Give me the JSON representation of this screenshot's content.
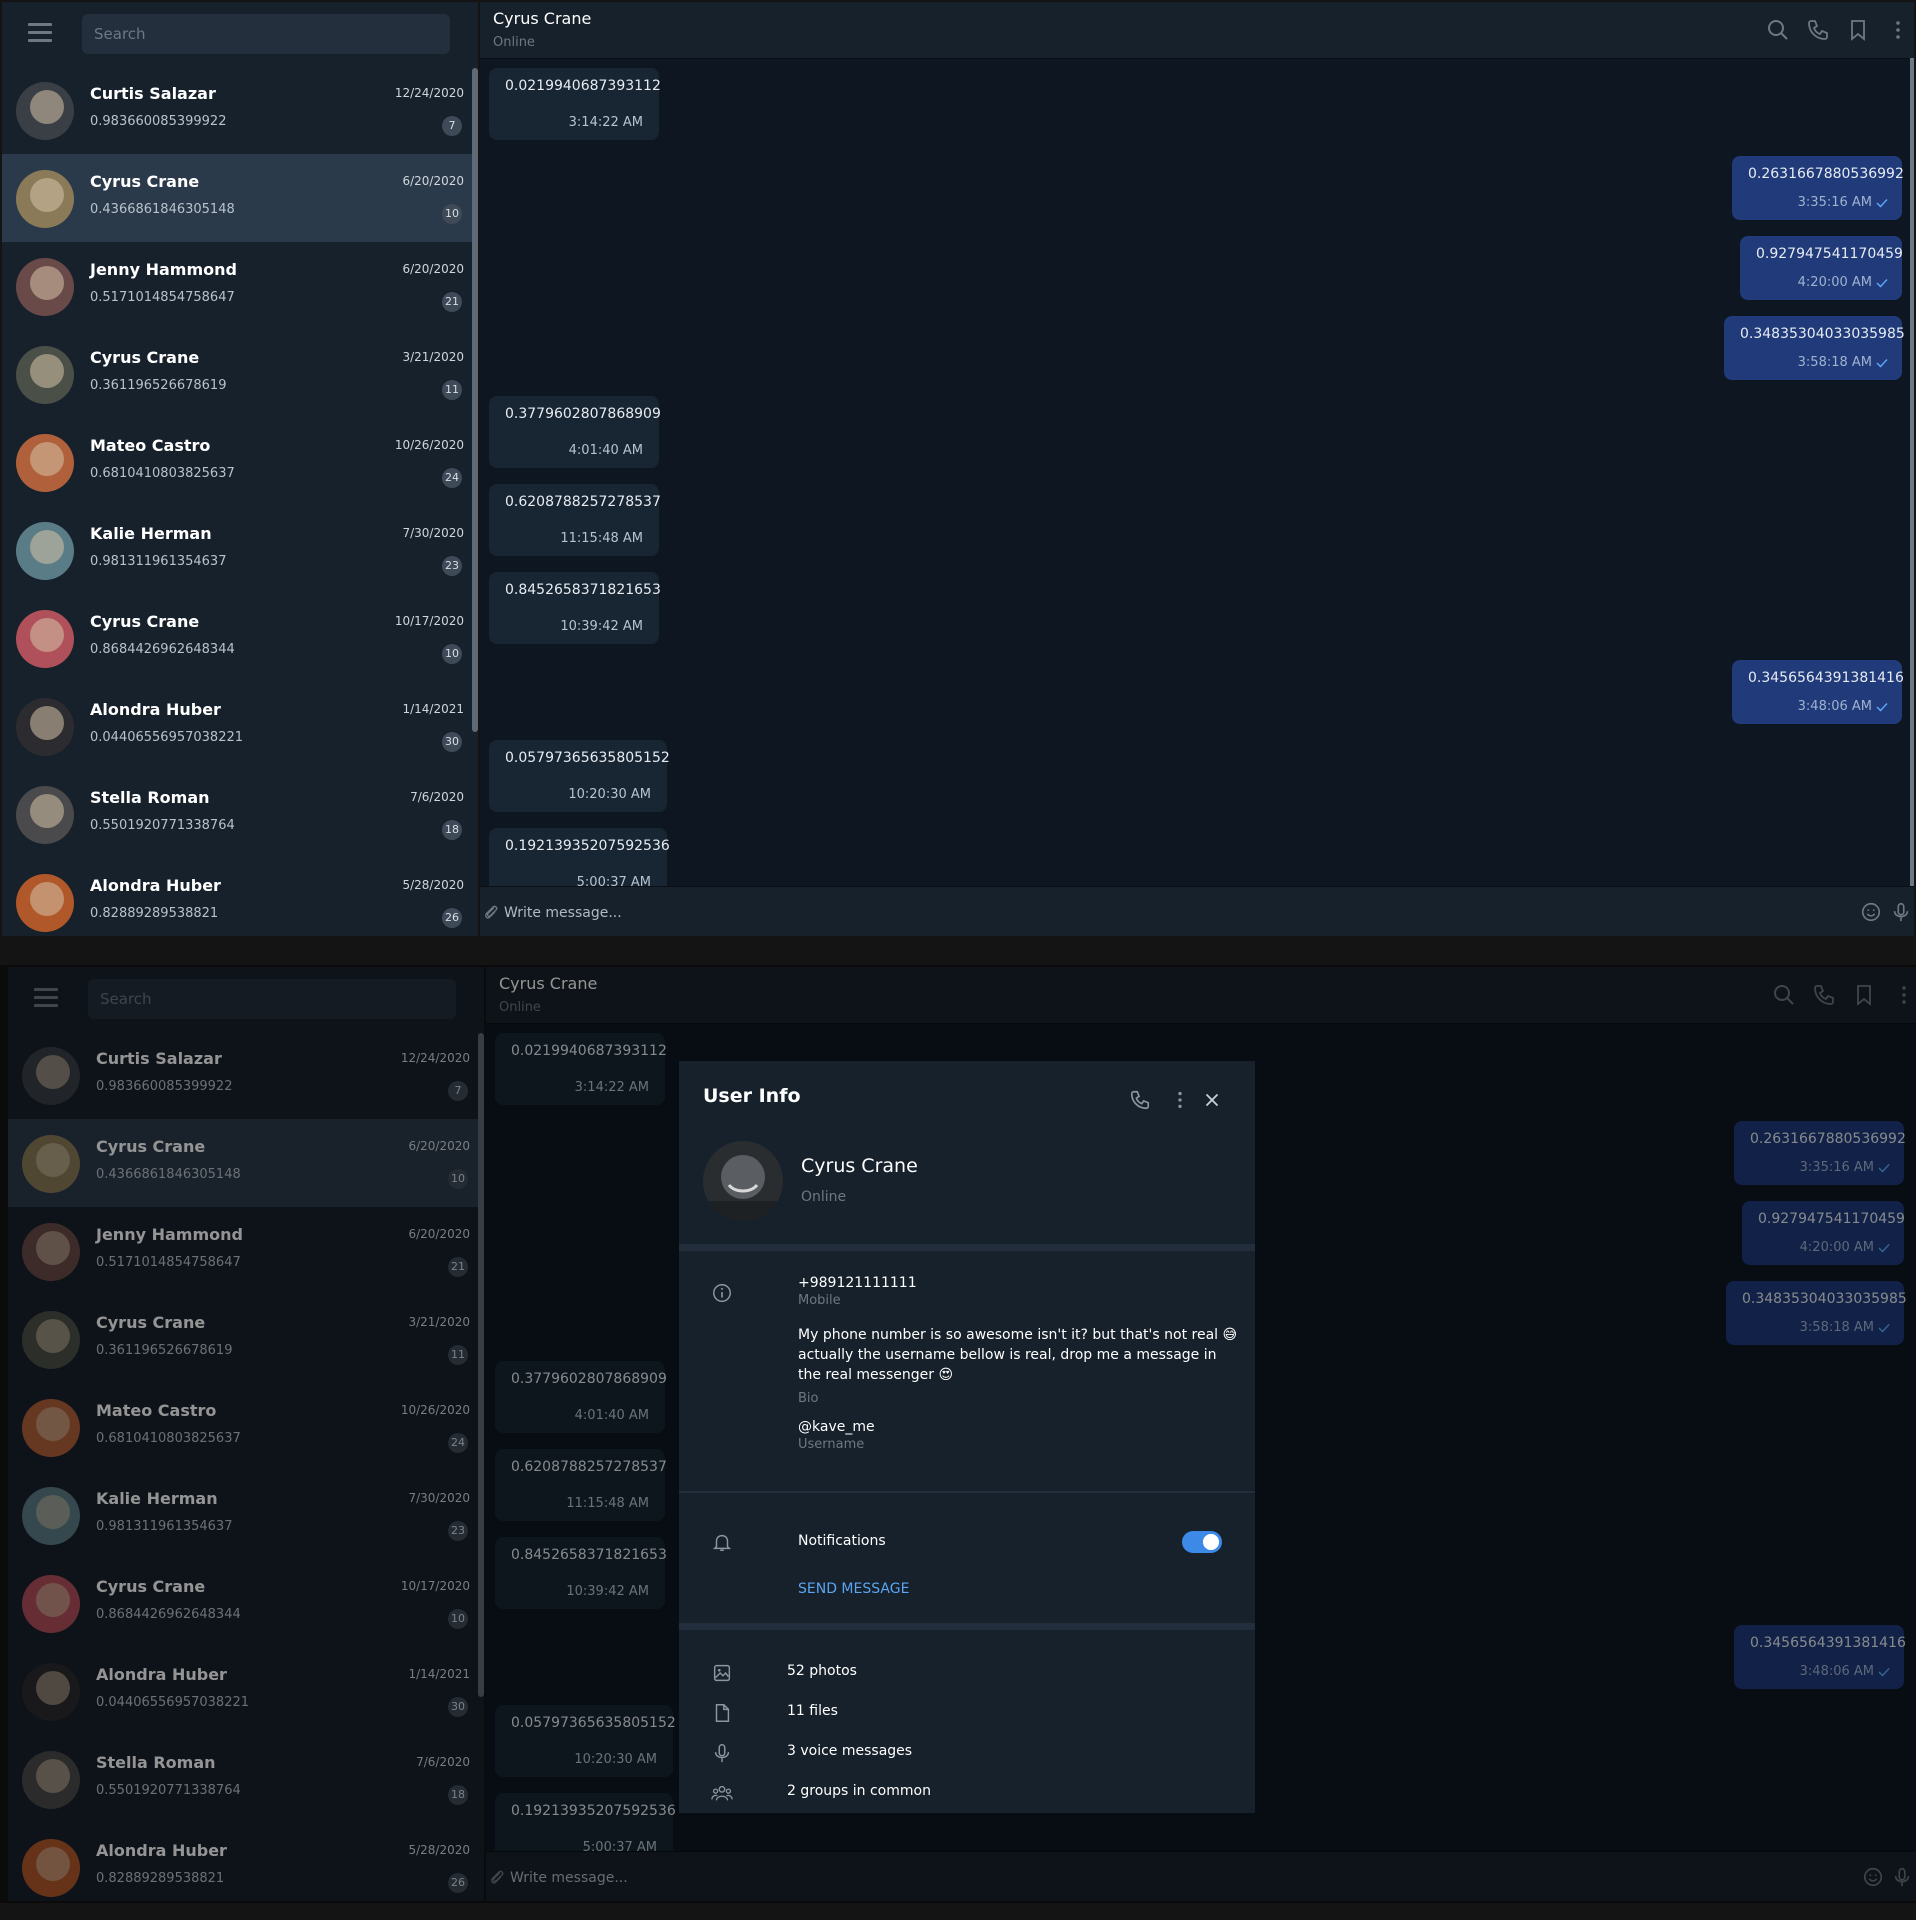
{
  "search": {
    "placeholder": "Search"
  },
  "chats": [
    {
      "name": "Curtis Salazar",
      "last": "0.983660085399922",
      "date": "12/24/2020",
      "unread": "7",
      "color": "#3a3f45"
    },
    {
      "name": "Cyrus Crane",
      "last": "0.4366861846305148",
      "date": "6/20/2020",
      "unread": "10",
      "color": "#8a7a58"
    },
    {
      "name": "Jenny Hammond",
      "last": "0.5171014854758647",
      "date": "6/20/2020",
      "unread": "21",
      "color": "#6a4a48"
    },
    {
      "name": "Cyrus Crane",
      "last": "0.361196526678619",
      "date": "3/21/2020",
      "unread": "11",
      "color": "#4a5048"
    },
    {
      "name": "Mateo Castro",
      "last": "0.6810410803825637",
      "date": "10/26/2020",
      "unread": "24",
      "color": "#b0603a"
    },
    {
      "name": "Kalie Herman",
      "last": "0.981311961354637",
      "date": "7/30/2020",
      "unread": "23",
      "color": "#5a7c86"
    },
    {
      "name": "Cyrus Crane",
      "last": "0.8684426962648344",
      "date": "10/17/2020",
      "unread": "10",
      "color": "#b0505a"
    },
    {
      "name": "Alondra Huber",
      "last": "0.04406556957038221",
      "date": "1/14/2021",
      "unread": "30",
      "color": "#2c2c30"
    },
    {
      "name": "Stella Roman",
      "last": "0.5501920771338764",
      "date": "7/6/2020",
      "unread": "18",
      "color": "#4a4a4c"
    },
    {
      "name": "Alondra Huber",
      "last": "0.82889289538821",
      "date": "5/28/2020",
      "unread": "26",
      "color": "#b0582a"
    }
  ],
  "conversation": {
    "title": "Cyrus Crane",
    "status": "Online"
  },
  "messages": [
    {
      "dir": "in",
      "text": "0.0219940687393112",
      "time": "3:14:22 AM"
    },
    {
      "dir": "out",
      "text": "0.2631667880536992",
      "time": "3:35:16 AM"
    },
    {
      "dir": "out",
      "text": "0.927947541170459",
      "time": "4:20:00 AM"
    },
    {
      "dir": "out",
      "text": "0.34835304033035985",
      "time": "3:58:18 AM"
    },
    {
      "dir": "in",
      "text": "0.3779602807868909",
      "time": "4:01:40 AM"
    },
    {
      "dir": "in",
      "text": "0.6208788257278537",
      "time": "11:15:48 AM"
    },
    {
      "dir": "in",
      "text": "0.8452658371821653",
      "time": "10:39:42 AM"
    },
    {
      "dir": "out",
      "text": "0.3456564391381416",
      "time": "3:48:06 AM"
    },
    {
      "dir": "in",
      "text": "0.05797365635805152",
      "time": "10:20:30 AM"
    },
    {
      "dir": "in",
      "text": "0.19213935207592536",
      "time": "5:00:37 AM"
    }
  ],
  "composer": {
    "placeholder": "Write message..."
  },
  "user_info": {
    "title": "User Info",
    "name": "Cyrus Crane",
    "status": "Online",
    "phone": "+989121111111",
    "phone_label": "Mobile",
    "bio": "My phone number is so awesome isn't it? but that's not real 😅 actually the username bellow is real, drop me a message in the real messenger 😍",
    "bio_label": "Bio",
    "username": "@kave_me",
    "username_label": "Username",
    "notifications_label": "Notifications",
    "notifications_on": true,
    "send_message": "SEND MESSAGE",
    "media": [
      {
        "icon": "photo-icon",
        "label": "52 photos"
      },
      {
        "icon": "file-icon",
        "label": "11 files"
      },
      {
        "icon": "microphone-icon",
        "label": "3 voice messages"
      },
      {
        "icon": "group-icon",
        "label": "2 groups in common"
      }
    ]
  },
  "colors": {
    "sidebar": "#17212b",
    "background": "#0e1621",
    "incoming": "#182533",
    "outgoing": "#203a7a",
    "accent": "#3c89e8"
  }
}
